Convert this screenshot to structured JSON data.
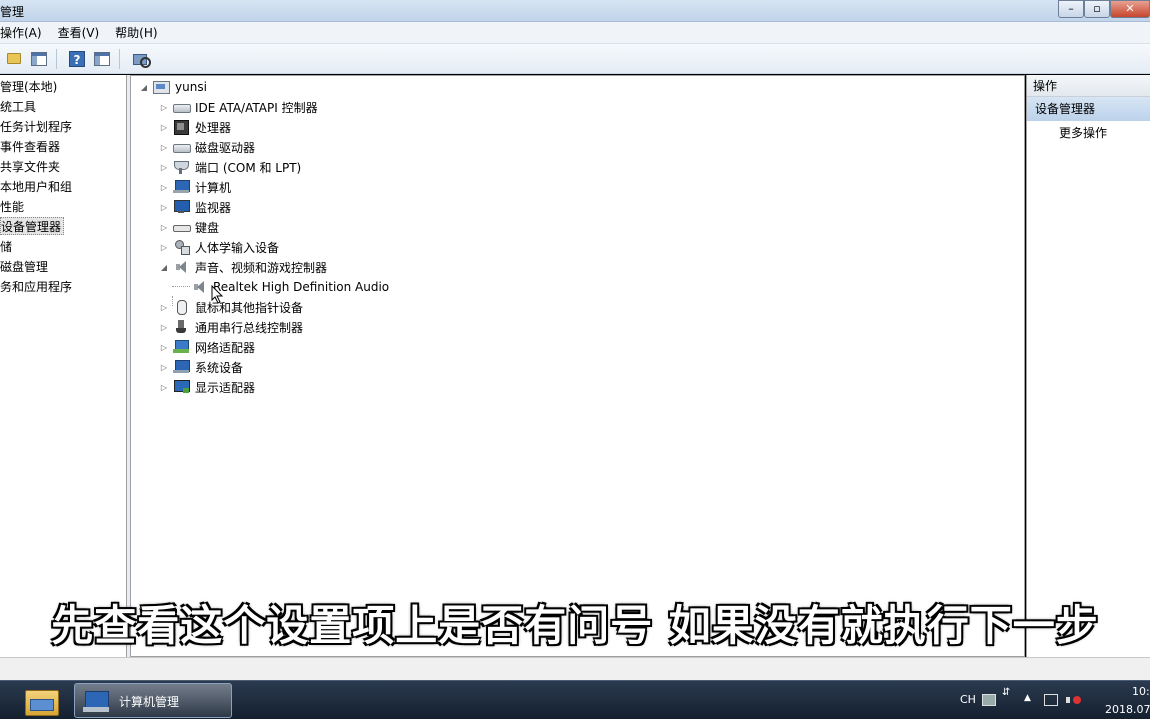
{
  "window": {
    "title": "管理"
  },
  "menu": {
    "items": [
      "操作(A)",
      "查看(V)",
      "帮助(H)"
    ]
  },
  "left_tree": {
    "items": [
      {
        "label": "管理(本地)",
        "selected": false
      },
      {
        "label": "统工具",
        "selected": false
      },
      {
        "label": "任务计划程序",
        "selected": false
      },
      {
        "label": "事件查看器",
        "selected": false
      },
      {
        "label": "共享文件夹",
        "selected": false
      },
      {
        "label": "本地用户和组",
        "selected": false
      },
      {
        "label": "性能",
        "selected": false
      },
      {
        "label": "设备管理器",
        "selected": true
      },
      {
        "label": "储",
        "selected": false
      },
      {
        "label": "磁盘管理",
        "selected": false
      },
      {
        "label": "务和应用程序",
        "selected": false
      }
    ]
  },
  "device_tree": {
    "root": "yunsi",
    "categories": [
      {
        "label": "IDE ATA/ATAPI 控制器",
        "icon": "ide-controller-icon"
      },
      {
        "label": "处理器",
        "icon": "processor-icon"
      },
      {
        "label": "磁盘驱动器",
        "icon": "disk-drive-icon"
      },
      {
        "label": "端口 (COM 和 LPT)",
        "icon": "port-icon"
      },
      {
        "label": "计算机",
        "icon": "computer-icon"
      },
      {
        "label": "监视器",
        "icon": "monitor-icon"
      },
      {
        "label": "键盘",
        "icon": "keyboard-icon"
      },
      {
        "label": "人体学输入设备",
        "icon": "hid-icon"
      },
      {
        "label": "声音、视频和游戏控制器",
        "icon": "sound-icon",
        "expanded": true
      },
      {
        "label": "鼠标和其他指针设备",
        "icon": "mouse-icon"
      },
      {
        "label": "通用串行总线控制器",
        "icon": "usb-icon"
      },
      {
        "label": "网络适配器",
        "icon": "network-adapter-icon"
      },
      {
        "label": "系统设备",
        "icon": "system-device-icon"
      },
      {
        "label": "显示适配器",
        "icon": "display-adapter-icon"
      }
    ],
    "sound_child": "Realtek High Definition Audio"
  },
  "actions_pane": {
    "header": "操作",
    "selected": "设备管理器",
    "more": "更多操作"
  },
  "subtitle": "先查看这个设置项上是否有问号 如果没有就执行下一步",
  "taskbar": {
    "task_label": "计算机管理",
    "lang": "CH",
    "time": "10:",
    "date": "2018.07"
  }
}
